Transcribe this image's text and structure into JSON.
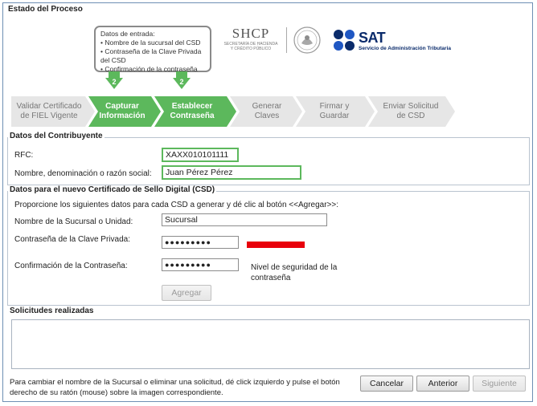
{
  "process": {
    "title": "Estado del Proceso",
    "tooltip": {
      "heading": "Datos de entrada:",
      "items": [
        "• Nombre de la sucursal del CSD",
        "• Contraseña de la Clave Privada",
        "  del CSD",
        "• Confirmación de la contraseña"
      ]
    },
    "markers": [
      "2",
      "2"
    ],
    "steps": [
      {
        "label": "Validar Certificado de FIEL Vigente",
        "state": "inactive"
      },
      {
        "label": "Capturar Información",
        "state": "active"
      },
      {
        "label": "Establecer Contraseña",
        "state": "active"
      },
      {
        "label": "Generar Claves",
        "state": "inactive"
      },
      {
        "label": "Firmar y Guardar",
        "state": "inactive"
      },
      {
        "label": "Enviar Solicitud de CSD",
        "state": "inactive"
      }
    ],
    "logos": {
      "shcp": "SHCP",
      "shcp_sub_1": "SECRETARÍA DE HACIENDA",
      "shcp_sub_2": "Y CRÉDITO PÚBLICO",
      "sat": "SAT",
      "sat_sub": "Servicio de Administración Tributaria"
    }
  },
  "taxpayer": {
    "title": "Datos del Contribuyente",
    "rfc_label": "RFC:",
    "rfc_value": "XAXX010101111",
    "name_label": "Nombre, denominación o razón social:",
    "name_value": "Juan Pérez Pérez"
  },
  "csd": {
    "title": "Datos para el nuevo Certificado de Sello Digital (CSD)",
    "instructions": "Proporcione los siguientes datos para cada CSD a generar y dé clic al botón <<Agregar>>:",
    "branch_label": "Nombre de la Sucursal o Unidad:",
    "branch_value": "Sucursal",
    "password_label": "Contraseña de la Clave Privada:",
    "password_value": "●●●●●●●●●",
    "confirm_label": "Confirmación de la Contraseña:",
    "confirm_value": "●●●●●●●●●",
    "strength_label_1": "Nivel de seguridad de la",
    "strength_label_2": "contraseña",
    "add_button": "Agregar"
  },
  "requests": {
    "title": "Solicitudes realizadas"
  },
  "footer": {
    "hint_1": "Para cambiar el nombre de la Sucursal o eliminar una solicitud, dé click izquierdo y pulse el botón",
    "hint_2": "derecho de su ratón (mouse) sobre la imagen correspondiente.",
    "cancel_button": "Cancelar",
    "previous_button": "Anterior",
    "next_button": "Siguiente"
  },
  "colors": {
    "accent_green": "#5cb85c",
    "step_inactive": "#e6e6e6",
    "strength_weak": "#e8000b",
    "sat_blue": "#0a2b6b"
  }
}
